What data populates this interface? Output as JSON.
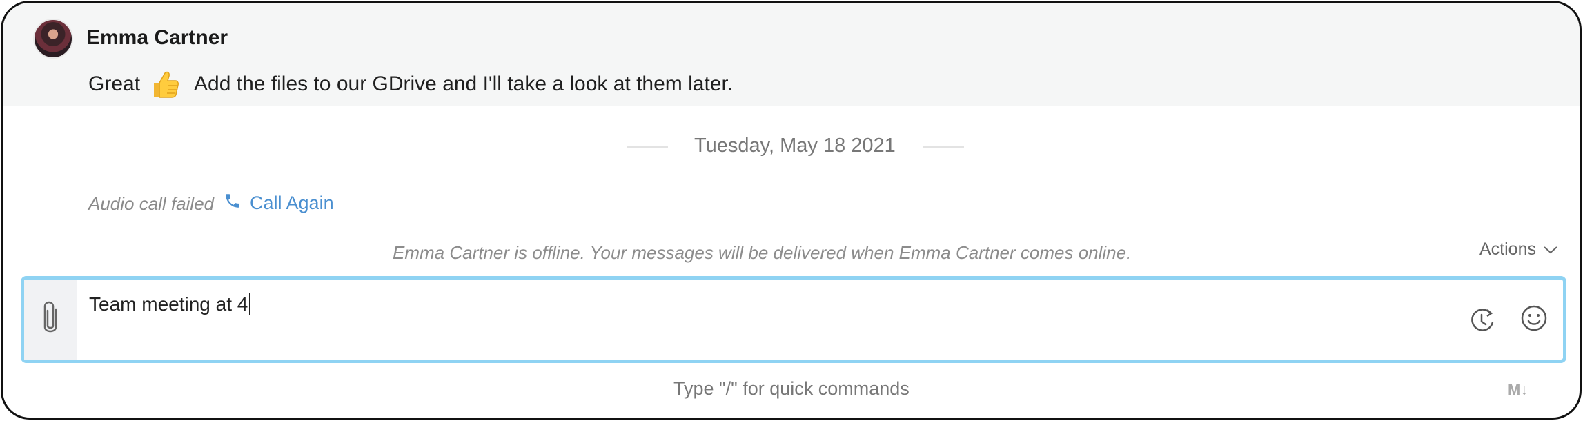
{
  "message": {
    "sender": "Emma Cartner",
    "text_before": "Great",
    "emoji": "thumbs-up",
    "text_after": "Add the files to our GDrive and I'll take a look at them later."
  },
  "date_separator": "Tuesday, May 18 2021",
  "call_event": {
    "status": "Audio call failed",
    "action_label": "Call Again"
  },
  "offline_notice": "Emma Cartner is offline. Your messages will be delivered when Emma Cartner comes online.",
  "actions_label": "Actions",
  "composer": {
    "value": "Team meeting at 4"
  },
  "hint": "Type \"/\" for quick commands",
  "markdown_icon_label": "M↓",
  "colors": {
    "accent_blue": "#4a8fd0",
    "composer_border": "#8fd3f3"
  },
  "icons": [
    "avatar",
    "thumbs-up-emoji",
    "phone-icon",
    "chevron-down-icon",
    "paperclip-icon",
    "schedule-icon",
    "emoji-icon",
    "markdown-icon"
  ]
}
